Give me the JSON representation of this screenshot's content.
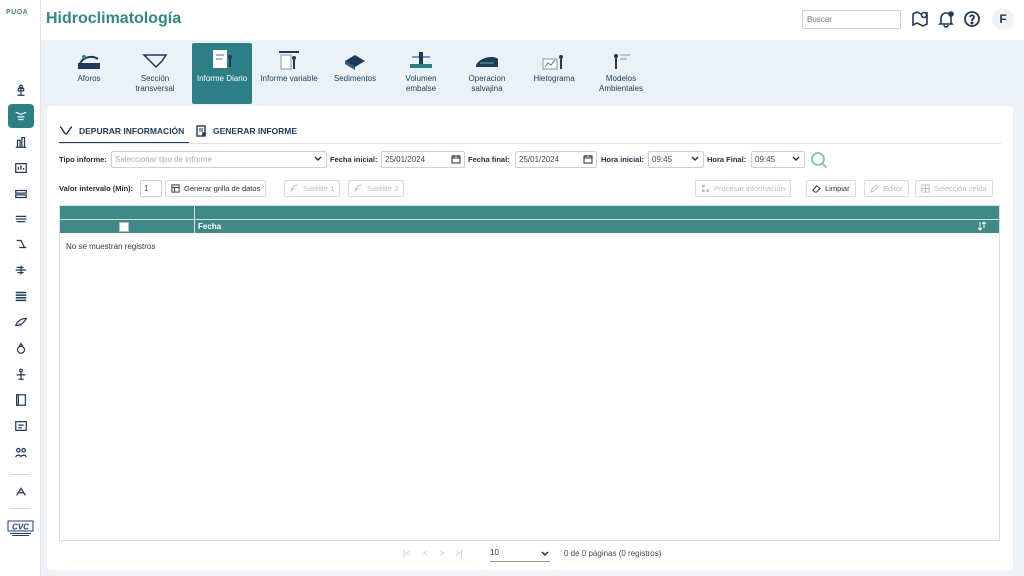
{
  "sidebar": {
    "logo_text": "PUOA",
    "items": [
      "gauge-icon",
      "cross-section-icon",
      "building-icon",
      "chart-icon",
      "stacked-icon",
      "channel-icon",
      "flow-icon",
      "wind-icon",
      "layers-icon",
      "fish-icon",
      "bag-icon",
      "person-icon",
      "book-icon",
      "report-icon",
      "group-icon",
      "tools-icon"
    ]
  },
  "header": {
    "title": "Hidroclimatología",
    "search_placeholder": "Buscar",
    "avatar_letter": "F"
  },
  "modules": [
    {
      "label": "Aforos"
    },
    {
      "label": "Sección transversal"
    },
    {
      "label": "Informe Diario"
    },
    {
      "label": "Informe variable"
    },
    {
      "label": "Sedimentos"
    },
    {
      "label": "Volumen embalse"
    },
    {
      "label": "Operacion salvajina"
    },
    {
      "label": "Hietograma"
    },
    {
      "label": "Modelos Ambientales"
    }
  ],
  "tabs": {
    "depurar": "DEPURAR INFORMACIÓN",
    "generar": "GENERAR INFORME"
  },
  "filters": {
    "tipo_label": "Tipo informe:",
    "tipo_placeholder": "Seleccionar tipo de informe",
    "fecha_ini_label": "Fecha inicial:",
    "fecha_ini_value": "25/01/2024",
    "fecha_fin_label": "Fecha final:",
    "fecha_fin_value": "25/01/2024",
    "hora_ini_label": "Hora inicial:",
    "hora_ini_value": "09:45",
    "hora_fin_label": "Hora Final:",
    "hora_fin_value": "09:45"
  },
  "actions": {
    "intervalo_label": "Valor intervalo (Min):",
    "intervalo_value": "1",
    "generar_grilla": "Generar grilla de datos",
    "satelite1": "Satélite 1",
    "satelite2": "Satélite 2",
    "procesar": "Procesar información",
    "limpiar": "Limpiar",
    "editor": "Editor",
    "seleccion": "Selección celda"
  },
  "grid": {
    "col_fecha": "Fecha",
    "empty_text": "No se muestran registros",
    "page_size": "10",
    "page_info": "0 de 0 páginas (0 registros)"
  }
}
